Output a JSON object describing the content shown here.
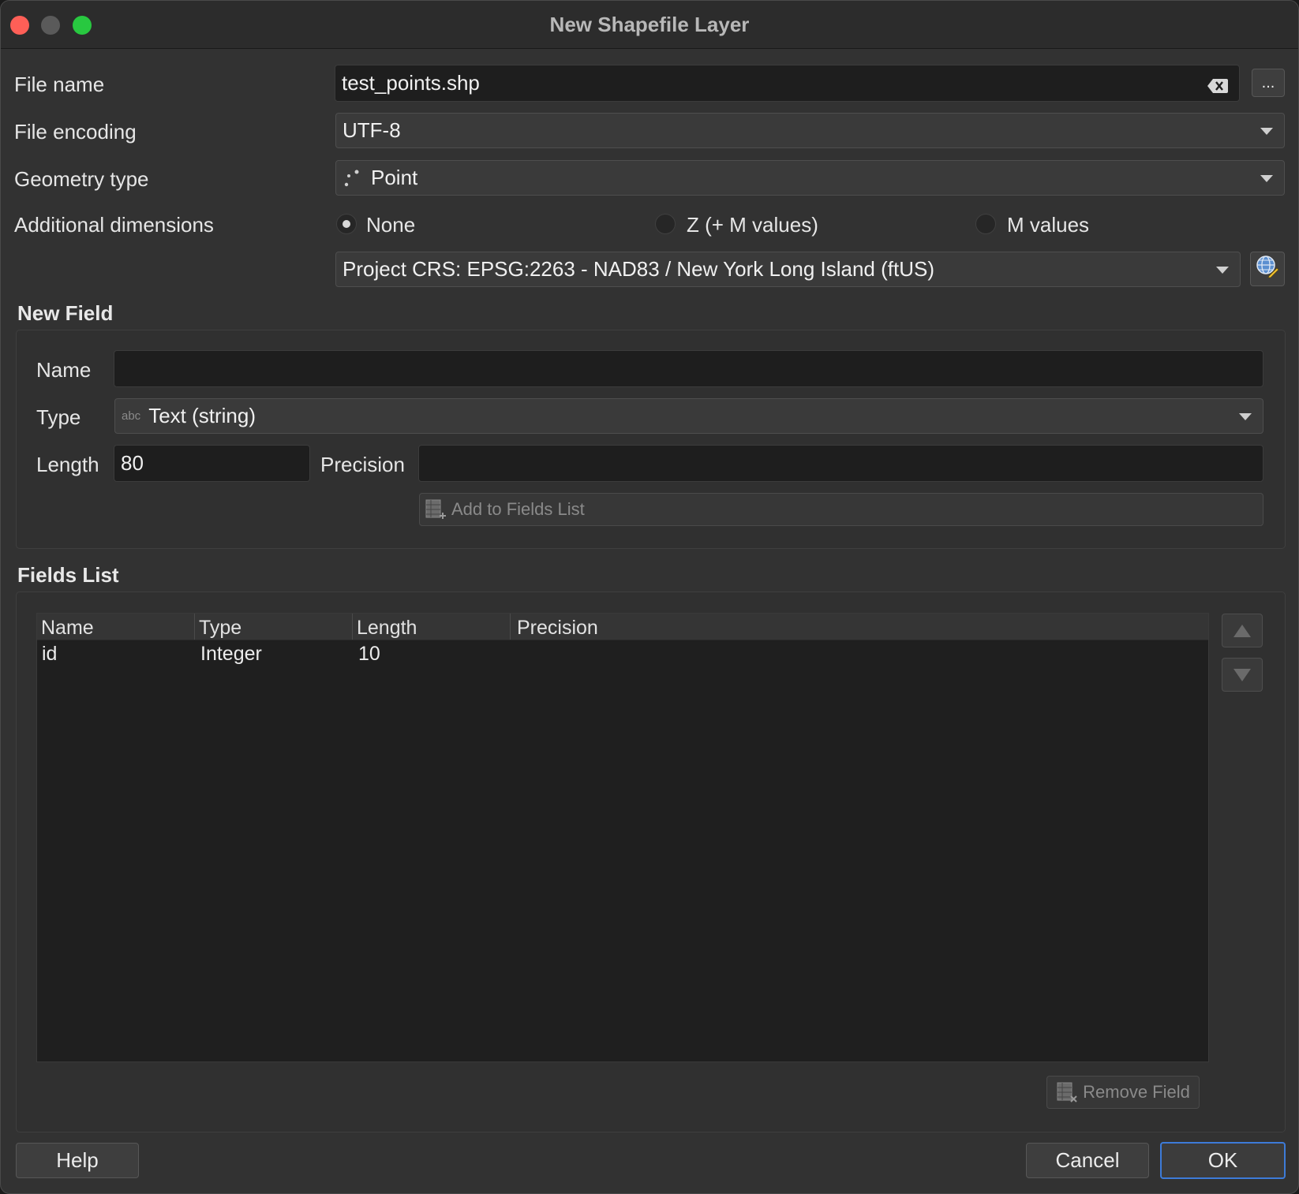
{
  "window": {
    "title": "New Shapefile Layer"
  },
  "file": {
    "name_label": "File name",
    "name_value": "test_points.shp",
    "browse_label": "...",
    "encoding_label": "File encoding",
    "encoding_value": "UTF-8",
    "geometry_label": "Geometry type",
    "geometry_value": "Point",
    "dimensions_label": "Additional dimensions",
    "dimensions_options": [
      "None",
      "Z (+ M values)",
      "M values"
    ],
    "dimensions_selected": "None",
    "crs_value": "Project CRS: EPSG:2263 - NAD83 / New York Long Island (ftUS)"
  },
  "new_field": {
    "title": "New Field",
    "name_label": "Name",
    "name_value": "",
    "type_label": "Type",
    "type_icon_text": "abc",
    "type_value": "Text (string)",
    "length_label": "Length",
    "length_value": "80",
    "precision_label": "Precision",
    "precision_value": "",
    "add_button": "Add to Fields List"
  },
  "fields_list": {
    "title": "Fields List",
    "columns": [
      "Name",
      "Type",
      "Length",
      "Precision"
    ],
    "rows": [
      {
        "name": "id",
        "type": "Integer",
        "length": "10",
        "precision": ""
      }
    ],
    "remove_button": "Remove Field"
  },
  "footer": {
    "help": "Help",
    "cancel": "Cancel",
    "ok": "OK"
  },
  "colors": {
    "accent": "#3d7bd8",
    "close": "#fe5f57",
    "maximize": "#28c840"
  }
}
